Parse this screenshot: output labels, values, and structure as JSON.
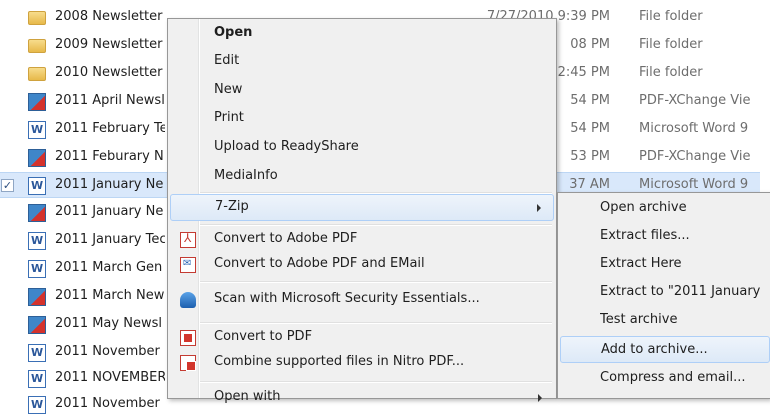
{
  "files": [
    {
      "name": "2008 Newsletter",
      "date": "7/27/2010 9:39 PM",
      "type": "File folder",
      "icon": "folder-icon"
    },
    {
      "name": "2009 Newsletter",
      "date": "08 PM",
      "type": "File folder",
      "icon": "folder-icon"
    },
    {
      "name": "2010 Newsletter",
      "date": "2:45 PM",
      "type": "File folder",
      "icon": "folder-icon"
    },
    {
      "name": "2011 April Newsl",
      "date": "54 PM",
      "type": "PDF-XChange Vie",
      "icon": "pdf-icon"
    },
    {
      "name": "2011 February Te",
      "date": "54 PM",
      "type": "Microsoft Word 9",
      "icon": "word-icon"
    },
    {
      "name": "2011 Feburary N",
      "date": "53 PM",
      "type": "PDF-XChange Vie",
      "icon": "pdf-icon"
    },
    {
      "name": "2011 January Ne",
      "date": "37 AM",
      "type": "Microsoft Word 9",
      "icon": "word-icon",
      "selected": true
    },
    {
      "name": "2011 January Ne",
      "date": "",
      "type": "",
      "icon": "pdf-icon"
    },
    {
      "name": "2011 January Tec",
      "date": "",
      "type": "",
      "icon": "word-icon"
    },
    {
      "name": "2011 March Gen",
      "date": "",
      "type": "",
      "icon": "word-icon"
    },
    {
      "name": "2011 March New",
      "date": "",
      "type": "",
      "icon": "pdf-icon"
    },
    {
      "name": "2011 May Newsl",
      "date": "",
      "type": "",
      "icon": "pdf-icon"
    },
    {
      "name": "2011 November",
      "date": "",
      "type": "",
      "icon": "word-icon"
    },
    {
      "name": "2011 NOVEMBER",
      "date": "",
      "type": "",
      "icon": "word-icon"
    },
    {
      "name": "2011 November",
      "date": "",
      "type": "",
      "icon": "word-icon"
    }
  ],
  "context_menu": {
    "open": "Open",
    "edit": "Edit",
    "new": "New",
    "print": "Print",
    "upload": "Upload to ReadyShare",
    "mediainfo": "MediaInfo",
    "sevenzip": "7-Zip",
    "convert_adobe": "Convert to Adobe PDF",
    "convert_adobe_email": "Convert to Adobe PDF and EMail",
    "scan": "Scan with Microsoft Security Essentials...",
    "convert_pdf": "Convert to PDF",
    "combine_nitro": "Combine supported files in Nitro PDF...",
    "open_with": "Open with"
  },
  "submenu": {
    "open_archive": "Open archive",
    "extract_files": "Extract files...",
    "extract_here": "Extract Here",
    "extract_to": "Extract to \"2011 January",
    "test_archive": "Test archive",
    "add_to_archive": "Add to archive...",
    "compress_email": "Compress and email..."
  },
  "checkbox_mark": "✓"
}
